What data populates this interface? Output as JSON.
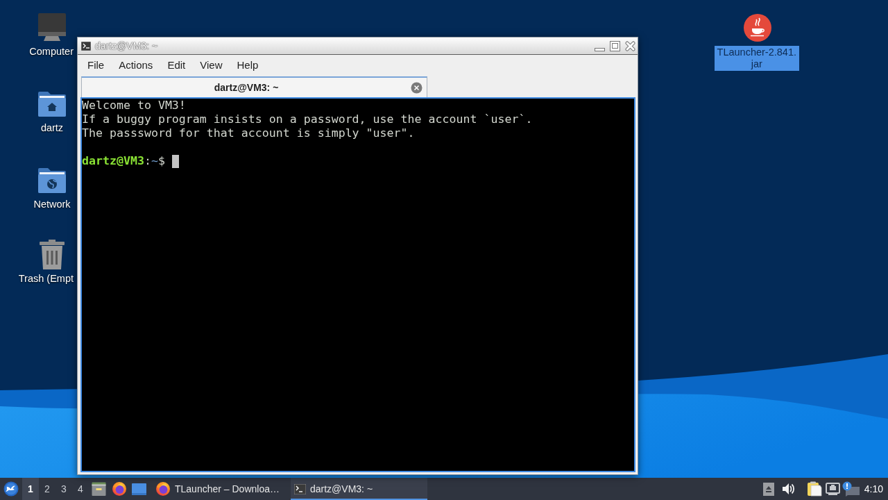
{
  "desktop": {
    "icons": [
      {
        "kind": "computer",
        "label_lines": [
          "Computer"
        ],
        "selected": false
      },
      {
        "kind": "home",
        "label_lines": [
          "dartz"
        ],
        "selected": false
      },
      {
        "kind": "network",
        "label_lines": [
          "Network"
        ],
        "selected": false
      },
      {
        "kind": "trash",
        "label_lines": [
          "Trash (Empt"
        ],
        "selected": false
      },
      {
        "kind": "java",
        "label_lines": [
          "TLauncher-2.841.",
          "jar"
        ],
        "selected": true
      }
    ]
  },
  "window": {
    "title": "dartz@VM3: ~",
    "menu": [
      "File",
      "Actions",
      "Edit",
      "View",
      "Help"
    ],
    "tabs": [
      {
        "label": "dartz@VM3: ~",
        "selected": true
      }
    ],
    "terminal": {
      "output": [
        "Welcome to VM3!",
        "If a buggy program insists on a password, use the account `user`.",
        "The passsword for that account is simply \"user\"."
      ],
      "prompt": {
        "user_host": "dartz@VM3",
        "separator": ":",
        "path": "~",
        "symbol": "$"
      },
      "cursor": true
    }
  },
  "taskbar": {
    "workspaces": [
      {
        "label": "1",
        "selected": true
      },
      {
        "label": "2",
        "selected": false
      },
      {
        "label": "3",
        "selected": false
      },
      {
        "label": "4",
        "selected": false
      }
    ],
    "tasks": [
      {
        "kind": "browser",
        "label": "TLauncher – Downloa…",
        "selected": false
      },
      {
        "kind": "terminal",
        "label": "dartz@VM3: ~",
        "selected": true
      }
    ],
    "clock": "4:10"
  }
}
